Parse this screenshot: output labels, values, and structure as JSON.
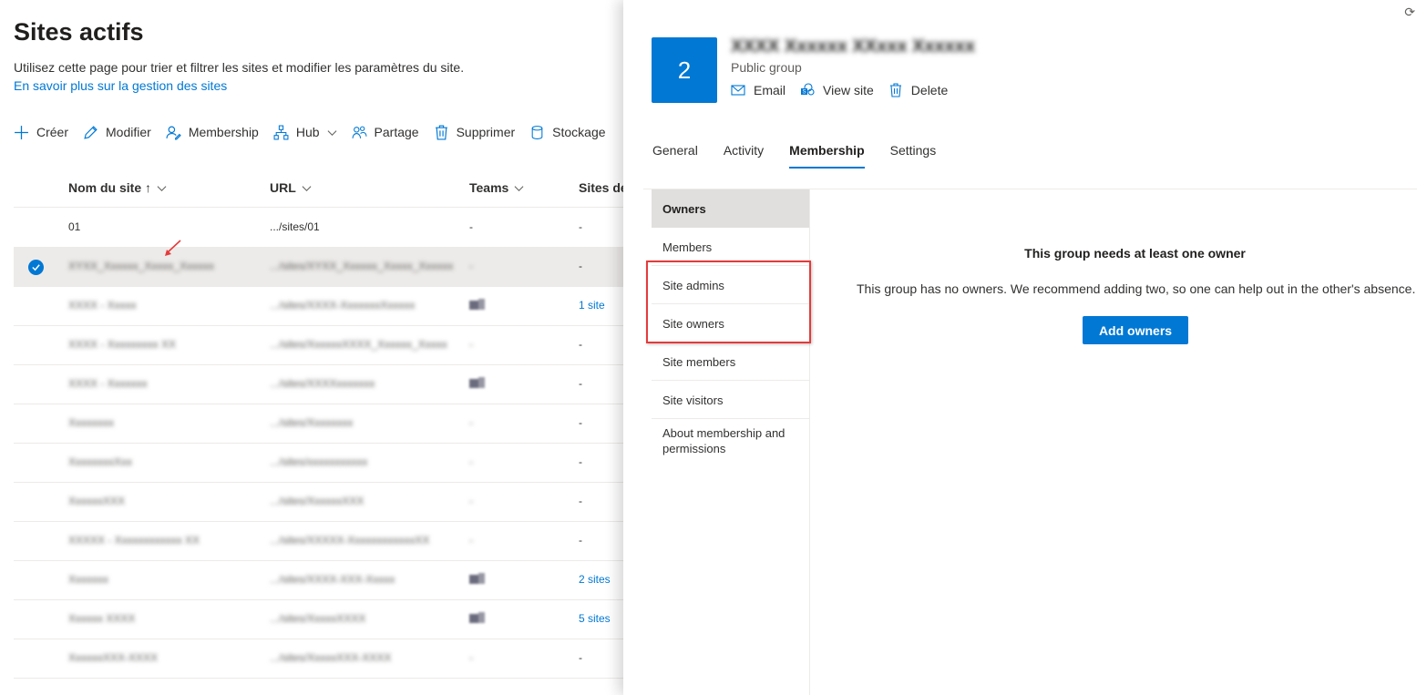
{
  "page": {
    "title": "Sites actifs",
    "description": "Utilisez cette page pour trier et filtrer les sites et modifier les paramètres du site.",
    "learn_more": "En savoir plus sur la gestion des sites"
  },
  "toolbar": {
    "create": "Créer",
    "edit": "Modifier",
    "membership": "Membership",
    "hub": "Hub",
    "sharing": "Partage",
    "delete": "Supprimer",
    "storage": "Stockage"
  },
  "table": {
    "columns": {
      "name": "Nom du site ↑",
      "url": "URL",
      "teams": "Teams",
      "hub_sites": "Sites de"
    },
    "rows": [
      {
        "name": "01",
        "url": ".../sites/01",
        "teams": "-",
        "hub": "-"
      },
      {
        "name": "XYXX_Xxxxxx_Xxxxx_Xxxxxx",
        "url": ".../sites/XYXX_Xxxxxx_Xxxxx_Xxxxxx",
        "teams": "-",
        "hub": "-"
      },
      {
        "name": "XXXX - Xxxxx",
        "url": ".../sites/XXXX-XxxxxxxXxxxxx",
        "teams": "",
        "hub": "1 site"
      },
      {
        "name": "XXXX - Xxxxxxxxx XX",
        "url": ".../sites/XxxxxxXXXX_Xxxxxx_Xxxxx",
        "teams": "-",
        "hub": "-"
      },
      {
        "name": "XXXX - Xxxxxxx",
        "url": ".../sites/XXXXxxxxxxx",
        "teams": "",
        "hub": "-"
      },
      {
        "name": "Xxxxxxxx",
        "url": ".../sites/Xxxxxxxx",
        "teams": "-",
        "hub": "-"
      },
      {
        "name": "XxxxxxxxXxx",
        "url": ".../sites/xxxxxxxxxxx",
        "teams": "-",
        "hub": "-"
      },
      {
        "name": "XxxxxxXXX",
        "url": ".../sites/XxxxxxXXX",
        "teams": "-",
        "hub": "-"
      },
      {
        "name": "XXXXX - Xxxxxxxxxxxx XX",
        "url": ".../sites/XXXXX-XxxxxxxxxxxxXX",
        "teams": "-",
        "hub": "-"
      },
      {
        "name": "Xxxxxxx",
        "url": ".../sites/XXXX-XXX-Xxxxx",
        "teams": "",
        "hub": "2 sites"
      },
      {
        "name": "Xxxxxx XXXX",
        "url": ".../sites/XxxxxXXXX",
        "teams": "",
        "hub": "5 sites"
      },
      {
        "name": "XxxxxxXXX-XXXX",
        "url": ".../sites/XxxxxXXX-XXXX",
        "teams": "-",
        "hub": "-"
      }
    ]
  },
  "panel": {
    "tile_text": "2",
    "group_name": "XXXX Xxxxxx XXxxx Xxxxxx",
    "group_type": "Public group",
    "actions": {
      "email": "Email",
      "view_site": "View site",
      "delete": "Delete"
    },
    "tabs": [
      "General",
      "Activity",
      "Membership",
      "Settings"
    ],
    "active_tab": "Membership",
    "subnav": [
      "Owners",
      "Members",
      "Site admins",
      "Site owners",
      "Site members",
      "Site visitors",
      "About membership and permissions"
    ],
    "message_title": "This group needs at least one owner",
    "message_text": "This group has no owners. We recommend adding two, so one can help out in the other's absence.",
    "add_button": "Add owners"
  },
  "colors": {
    "accent": "#0078d4",
    "highlight": "#e43b3b"
  },
  "icons": [
    "plus-icon",
    "pencil-icon",
    "people-icon",
    "hub-icon",
    "chevron-down-icon",
    "share-icon",
    "trash-icon",
    "storage-icon",
    "checkmark-icon",
    "teams-icon",
    "mail-icon",
    "sharepoint-icon",
    "refresh-icon"
  ]
}
